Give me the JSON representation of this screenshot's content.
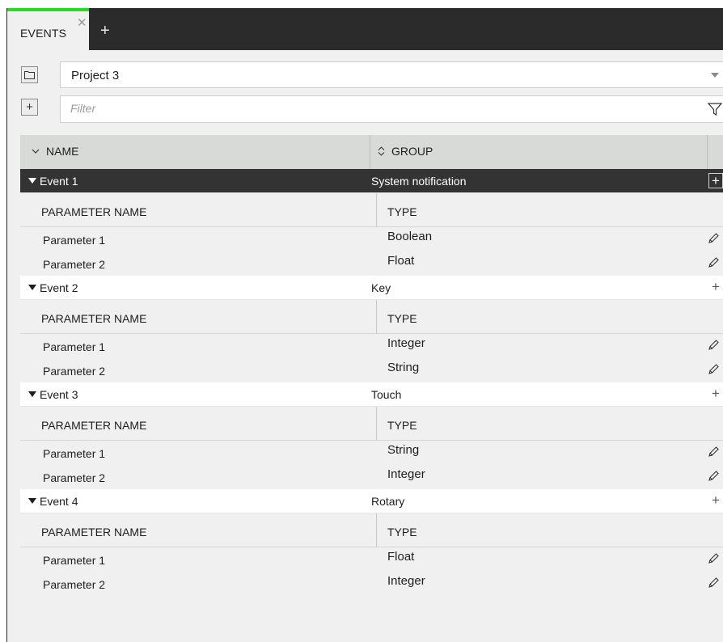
{
  "tab": {
    "label": "EVENTS",
    "close": "✕",
    "add": "+"
  },
  "project": {
    "value": "Project 3"
  },
  "filter": {
    "placeholder": "Filter",
    "value": ""
  },
  "table": {
    "headers": {
      "name": "NAME",
      "group": "GROUP"
    },
    "param_headers": {
      "name": "PARAMETER NAME",
      "type": "TYPE"
    },
    "events": [
      {
        "name": "Event 1",
        "group": "System notification",
        "selected": true,
        "params": [
          {
            "name": "Parameter 1",
            "type": "Boolean"
          },
          {
            "name": "Parameter 2",
            "type": "Float"
          }
        ]
      },
      {
        "name": "Event 2",
        "group": "Key",
        "selected": false,
        "params": [
          {
            "name": "Parameter 1",
            "type": "Integer"
          },
          {
            "name": "Parameter 2",
            "type": "String"
          }
        ]
      },
      {
        "name": "Event 3",
        "group": "Touch",
        "selected": false,
        "params": [
          {
            "name": "Parameter 1",
            "type": "String"
          },
          {
            "name": "Parameter 2",
            "type": "Integer"
          }
        ]
      },
      {
        "name": "Event 4",
        "group": "Rotary",
        "selected": false,
        "params": [
          {
            "name": "Parameter 1",
            "type": "Float"
          },
          {
            "name": "Parameter 2",
            "type": "Integer"
          }
        ]
      }
    ]
  },
  "icons": {
    "add_param": "+",
    "add_event": "+"
  },
  "colors": {
    "tab_accent": "#22dd22",
    "tabbar_bg": "#2b2b2b",
    "selected_row_bg": "#333333",
    "header_bg": "#d8dad8",
    "panel_bg": "#f0f0f0"
  }
}
